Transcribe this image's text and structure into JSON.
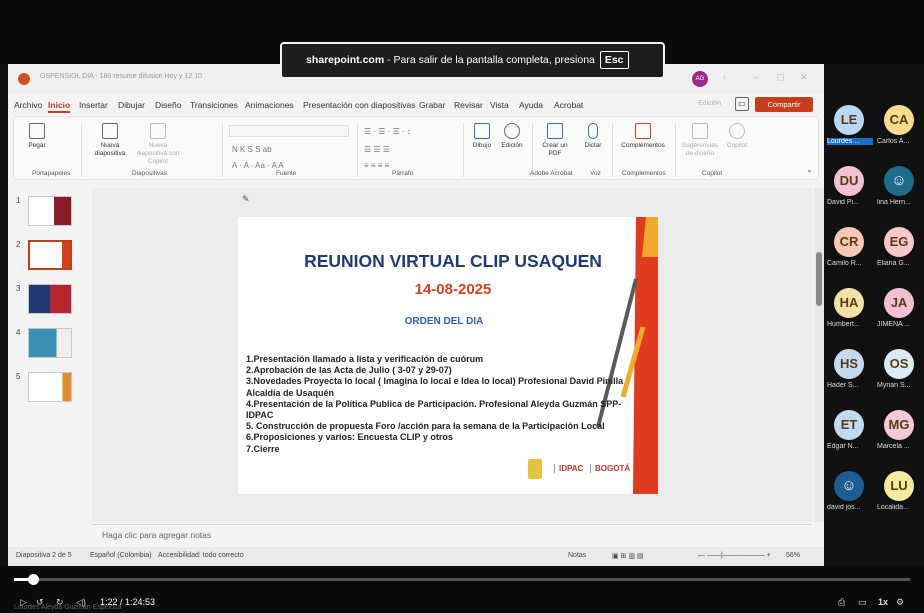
{
  "banner": {
    "site": "sharepoint.com",
    "message": " - Para salir de la pantalla completa, presiona ",
    "key": "Esc"
  },
  "ppt": {
    "window_title": "OSPENSIOL DIA - 180 resume difusion Hoy y 12 10",
    "avatar": "AG",
    "editing": "Edición",
    "share": "Compartir",
    "menus": [
      "Archivo",
      "Inicio",
      "Insertar",
      "Dibujar",
      "Diseño",
      "Transiciones",
      "Animaciones",
      "Presentación con diapositivas",
      "Grabar",
      "Revisar",
      "Vista",
      "Ayuda",
      "Acrobat"
    ],
    "ribbon": {
      "paste": "Pegar",
      "new_slide": "Nueva diapositiva",
      "new_slide_copilot": "Nueva diapositiva con Copilot",
      "draw": "Dibujo",
      "editing": "Edición",
      "create_pdf": "Crear un PDF",
      "dictate": "Dictar",
      "addins": "Complementos",
      "suggest": "Sugerencias de diseño",
      "copilot": "Copilot",
      "groups": [
        "Portapapeles",
        "Diapositivas",
        "Fuente",
        "Párrafo",
        "Adobe Acrobat",
        "Voz",
        "Complementos",
        "Copilot"
      ]
    },
    "thumb_numbers": [
      "1",
      "2",
      "3",
      "4",
      "5"
    ],
    "notes_placeholder": "Haga clic para agregar notas",
    "status": {
      "slide": "Diapositiva 2 de 5",
      "lang": "Español (Colombia)",
      "accessibility": "Accesibilidad: todo correcto",
      "notes": "Notas",
      "zoom": "56%"
    }
  },
  "slide": {
    "title": "REUNION  VIRTUAL CLIP USAQUEN",
    "date": "14-08-2025",
    "orden": "ORDEN DEL DIA",
    "items": [
      "1.Presentación llamado a lista y verificación de cuórum",
      "2.Aprobación de las Acta de Julio ( 3-07 y 29-07)",
      "3.Novedades Proyecta lo local  ( Imagina lo local e Idea lo local) Profesional David Pinilla Alcaldía de Usaquén",
      "4.Presentación de la Política Publica de Participación. Profesional Aleyda Guzmán SPP-IDPAC",
      "5. Construcción de propuesta Foro /acción para la semana de la Participación Local",
      "6.Proposiciones y varios: Encuesta  CLIP y otros",
      "7.Cierre"
    ],
    "logo_idpac": "IDPAC",
    "logo_bogota": "BOGOTÁ"
  },
  "participants": [
    {
      "initials": "LE",
      "name": "Lourdes ...",
      "color": "#b9d8f5"
    },
    {
      "initials": "CA",
      "name": "Carlos A...",
      "color": "#f6dc8c"
    },
    {
      "initials": "DU",
      "name": "David Pi...",
      "color": "#f3c1d4"
    },
    {
      "initials": "",
      "name": "lina Hern...",
      "color": "#1d6c8a"
    },
    {
      "initials": "CR",
      "name": "Camilo R...",
      "color": "#f7c9b5"
    },
    {
      "initials": "EG",
      "name": "Eliana G...",
      "color": "#f7c7cb"
    },
    {
      "initials": "HA",
      "name": "Humbert...",
      "color": "#f3e2a5"
    },
    {
      "initials": "JA",
      "name": "JIMENA ...",
      "color": "#f1c0d2"
    },
    {
      "initials": "HS",
      "name": "Hader S...",
      "color": "#c2daf2"
    },
    {
      "initials": "OS",
      "name": "Myrian S...",
      "color": "#d7ecf6"
    },
    {
      "initials": "ET",
      "name": "Edgar N...",
      "color": "#c0daf3"
    },
    {
      "initials": "MG",
      "name": "Marcela ...",
      "color": "#f3c9d7"
    },
    {
      "initials": "",
      "name": "david jos...",
      "color": "#1c5d92"
    },
    {
      "initials": "LU",
      "name": "Localida...",
      "color": "#f4ec9c"
    }
  ],
  "player": {
    "time": "1:22 / 1:24:53",
    "speed": "1x",
    "progress": 0.02,
    "speaker": "Lourdes Aleyda Guzman Espinosa"
  },
  "colors": {
    "accent": "#c43e1c",
    "title_blue": "#1f3a75",
    "date_red": "#d2431c"
  }
}
